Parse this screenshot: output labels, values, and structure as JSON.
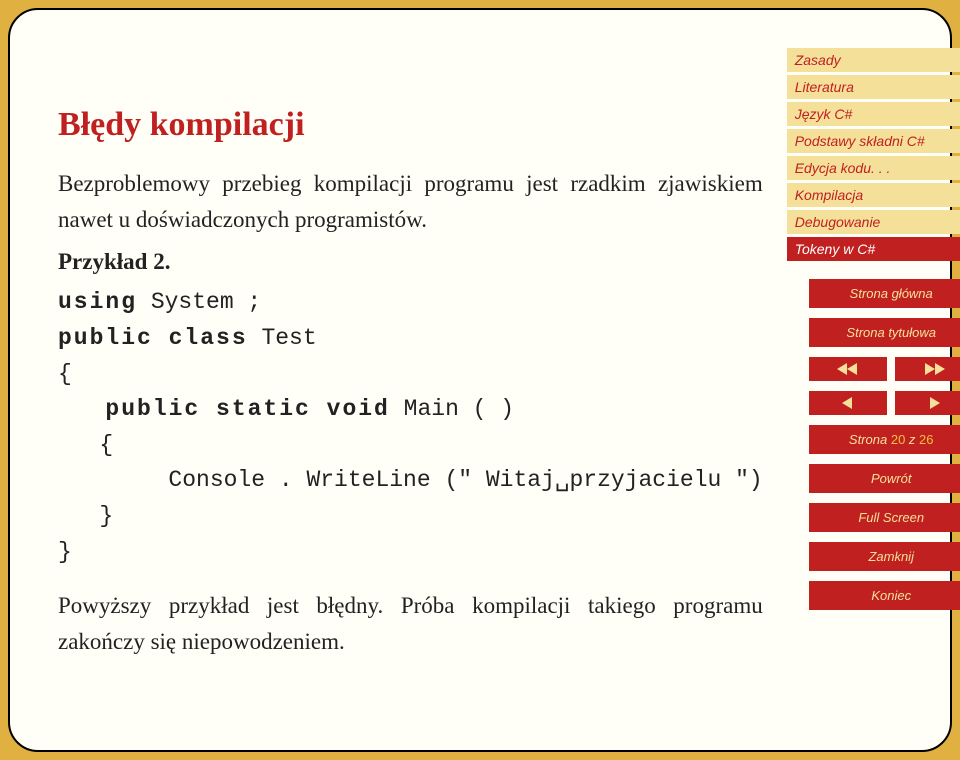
{
  "sidebar": {
    "items": [
      {
        "label": "Zasady",
        "active": false
      },
      {
        "label": "Literatura",
        "active": false
      },
      {
        "label": "Język C#",
        "active": false
      },
      {
        "label": "Podstawy składni C#",
        "active": false
      },
      {
        "label": "Edycja kodu. . .",
        "active": false
      },
      {
        "label": "Kompilacja",
        "active": false
      },
      {
        "label": "Debugowanie",
        "active": false
      },
      {
        "label": "Tokeny w C#",
        "active": true
      }
    ],
    "home": "Strona główna",
    "titlepage": "Strona tytułowa",
    "page_prefix": "Strona ",
    "page_current": "20",
    "page_sep": " z ",
    "page_total": "26",
    "back": "Powrót",
    "fullscreen": "Full Screen",
    "close": "Zamknij",
    "end": "Koniec"
  },
  "main": {
    "title": "Błędy kompilacji",
    "para1": "Bezproblemowy przebieg kompilacji programu jest rzadkim zjawiskiem nawet u doświadczonych programistów.",
    "subhead": "Przykład 2.",
    "code": {
      "l1a": "using",
      "l1b": " System ;",
      "l2a": "public class",
      "l2b": " Test",
      "l3": "{",
      "l4a": "   public static void",
      "l4b": " Main ( )",
      "l5": "   {",
      "l6": "        Console . WriteLine (\" Witaj␣przyjacielu \")",
      "l7": "   }",
      "l8": "}"
    },
    "para2": "Powyższy przykład jest błędny. Próba kompilacji takiego programu zakończy się niepowodzeniem."
  }
}
